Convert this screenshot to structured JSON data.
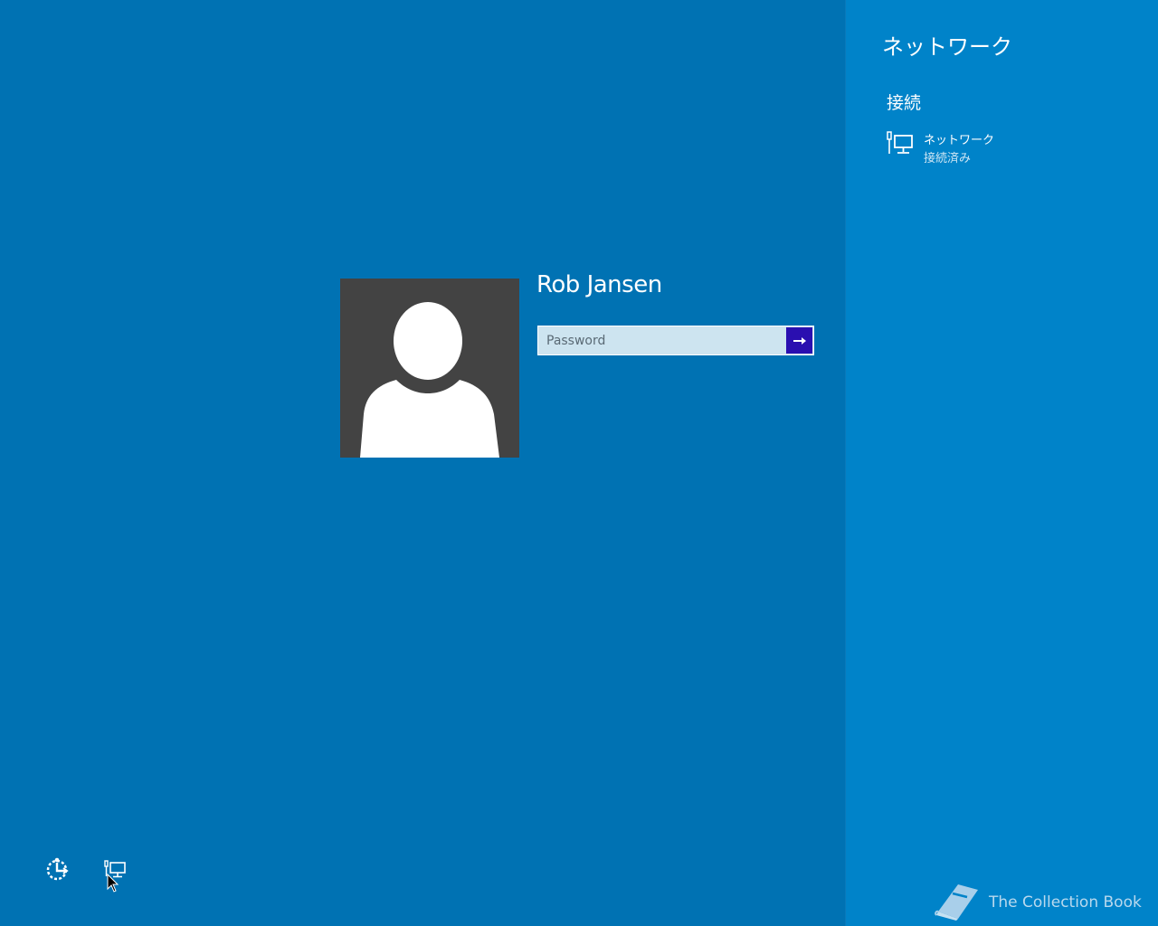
{
  "login": {
    "user_name": "Rob Jansen",
    "password_placeholder": "Password",
    "submit_icon": "arrow-right-icon",
    "avatar_icon": "default-user-avatar"
  },
  "bottom_bar": {
    "ease_of_access_icon": "ease-of-access-icon",
    "network_icon": "network-icon"
  },
  "network_pane": {
    "title": "ネットワーク",
    "section_label": "接続",
    "connections": [
      {
        "name": "ネットワーク",
        "status": "接続済み",
        "icon": "wired-network-icon"
      }
    ]
  },
  "watermark": {
    "text": "The Collection Book",
    "icon": "book-icon"
  },
  "colors": {
    "background": "#0072b3",
    "pane": "#0083c9",
    "avatar_tile": "#434343",
    "submit": "#2a0fb0",
    "password_field": "#cde4f0"
  }
}
